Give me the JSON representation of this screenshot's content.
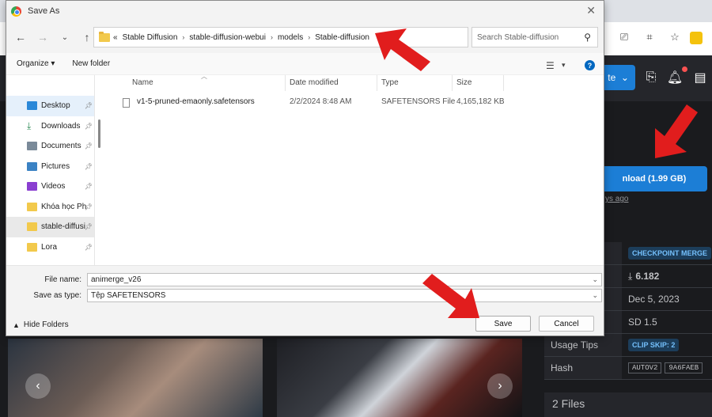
{
  "dialog": {
    "title": "Save As",
    "close": "✕",
    "breadcrumb": [
      "Stable Diffusion",
      "stable-diffusion-webui",
      "models",
      "Stable-diffusion"
    ],
    "breadcrumb_prefix": "«",
    "search_placeholder": "Search Stable-diffusion",
    "commands": {
      "organize": "Organize ▾",
      "new_folder": "New folder"
    },
    "nav_items": [
      {
        "label": "Desktop",
        "color": "#2b88d8",
        "pinned": true
      },
      {
        "label": "Downloads",
        "color": "#2e8b57",
        "pinned": true
      },
      {
        "label": "Documents",
        "color": "#7a8a99",
        "pinned": true
      },
      {
        "label": "Pictures",
        "color": "#3b82c4",
        "pinned": true
      },
      {
        "label": "Videos",
        "color": "#8a3fd1",
        "pinned": true
      },
      {
        "label": "Khóa học Ph",
        "color": "#f2c94c",
        "pinned": true
      },
      {
        "label": "stable-diffusi",
        "color": "#f2c94c",
        "pinned": true
      },
      {
        "label": "Lora",
        "color": "#f2c94c",
        "pinned": true
      }
    ],
    "columns": {
      "name": "Name",
      "date": "Date modified",
      "type": "Type",
      "size": "Size"
    },
    "files": [
      {
        "name": "v1-5-pruned-emaonly.safetensors",
        "date": "2/2/2024 8:48 AM",
        "type": "SAFETENSORS File",
        "size": "4,165,182 KB"
      }
    ],
    "file_name_label": "File name:",
    "file_name_value": "animerge_v26",
    "save_type_label": "Save as type:",
    "save_type_value": "Tệp SAFETENSORS",
    "hide_folders": "Hide Folders",
    "save_btn": "Save",
    "cancel_btn": "Cancel"
  },
  "background": {
    "create_btn": "te",
    "download_btn": "nload (1.99 GB)",
    "download_sub": "ys ago",
    "info": [
      {
        "label": "",
        "value": "CHECKPOINT MERGE",
        "badge": true
      },
      {
        "label": "",
        "value": "6.182",
        "icon": "⤓"
      },
      {
        "label": "",
        "value": "Dec 5, 2023"
      },
      {
        "label": "",
        "value": "SD 1.5"
      },
      {
        "label": "Usage Tips",
        "value": "CLIP SKIP: 2",
        "badge": true
      },
      {
        "label": "Hash",
        "value": "AUTOV2",
        "value2": "9A6FAEB"
      }
    ],
    "files_label": "2 Files"
  },
  "colors": {
    "arrow": "#e11d1d",
    "accent": "#1c7ed6"
  }
}
